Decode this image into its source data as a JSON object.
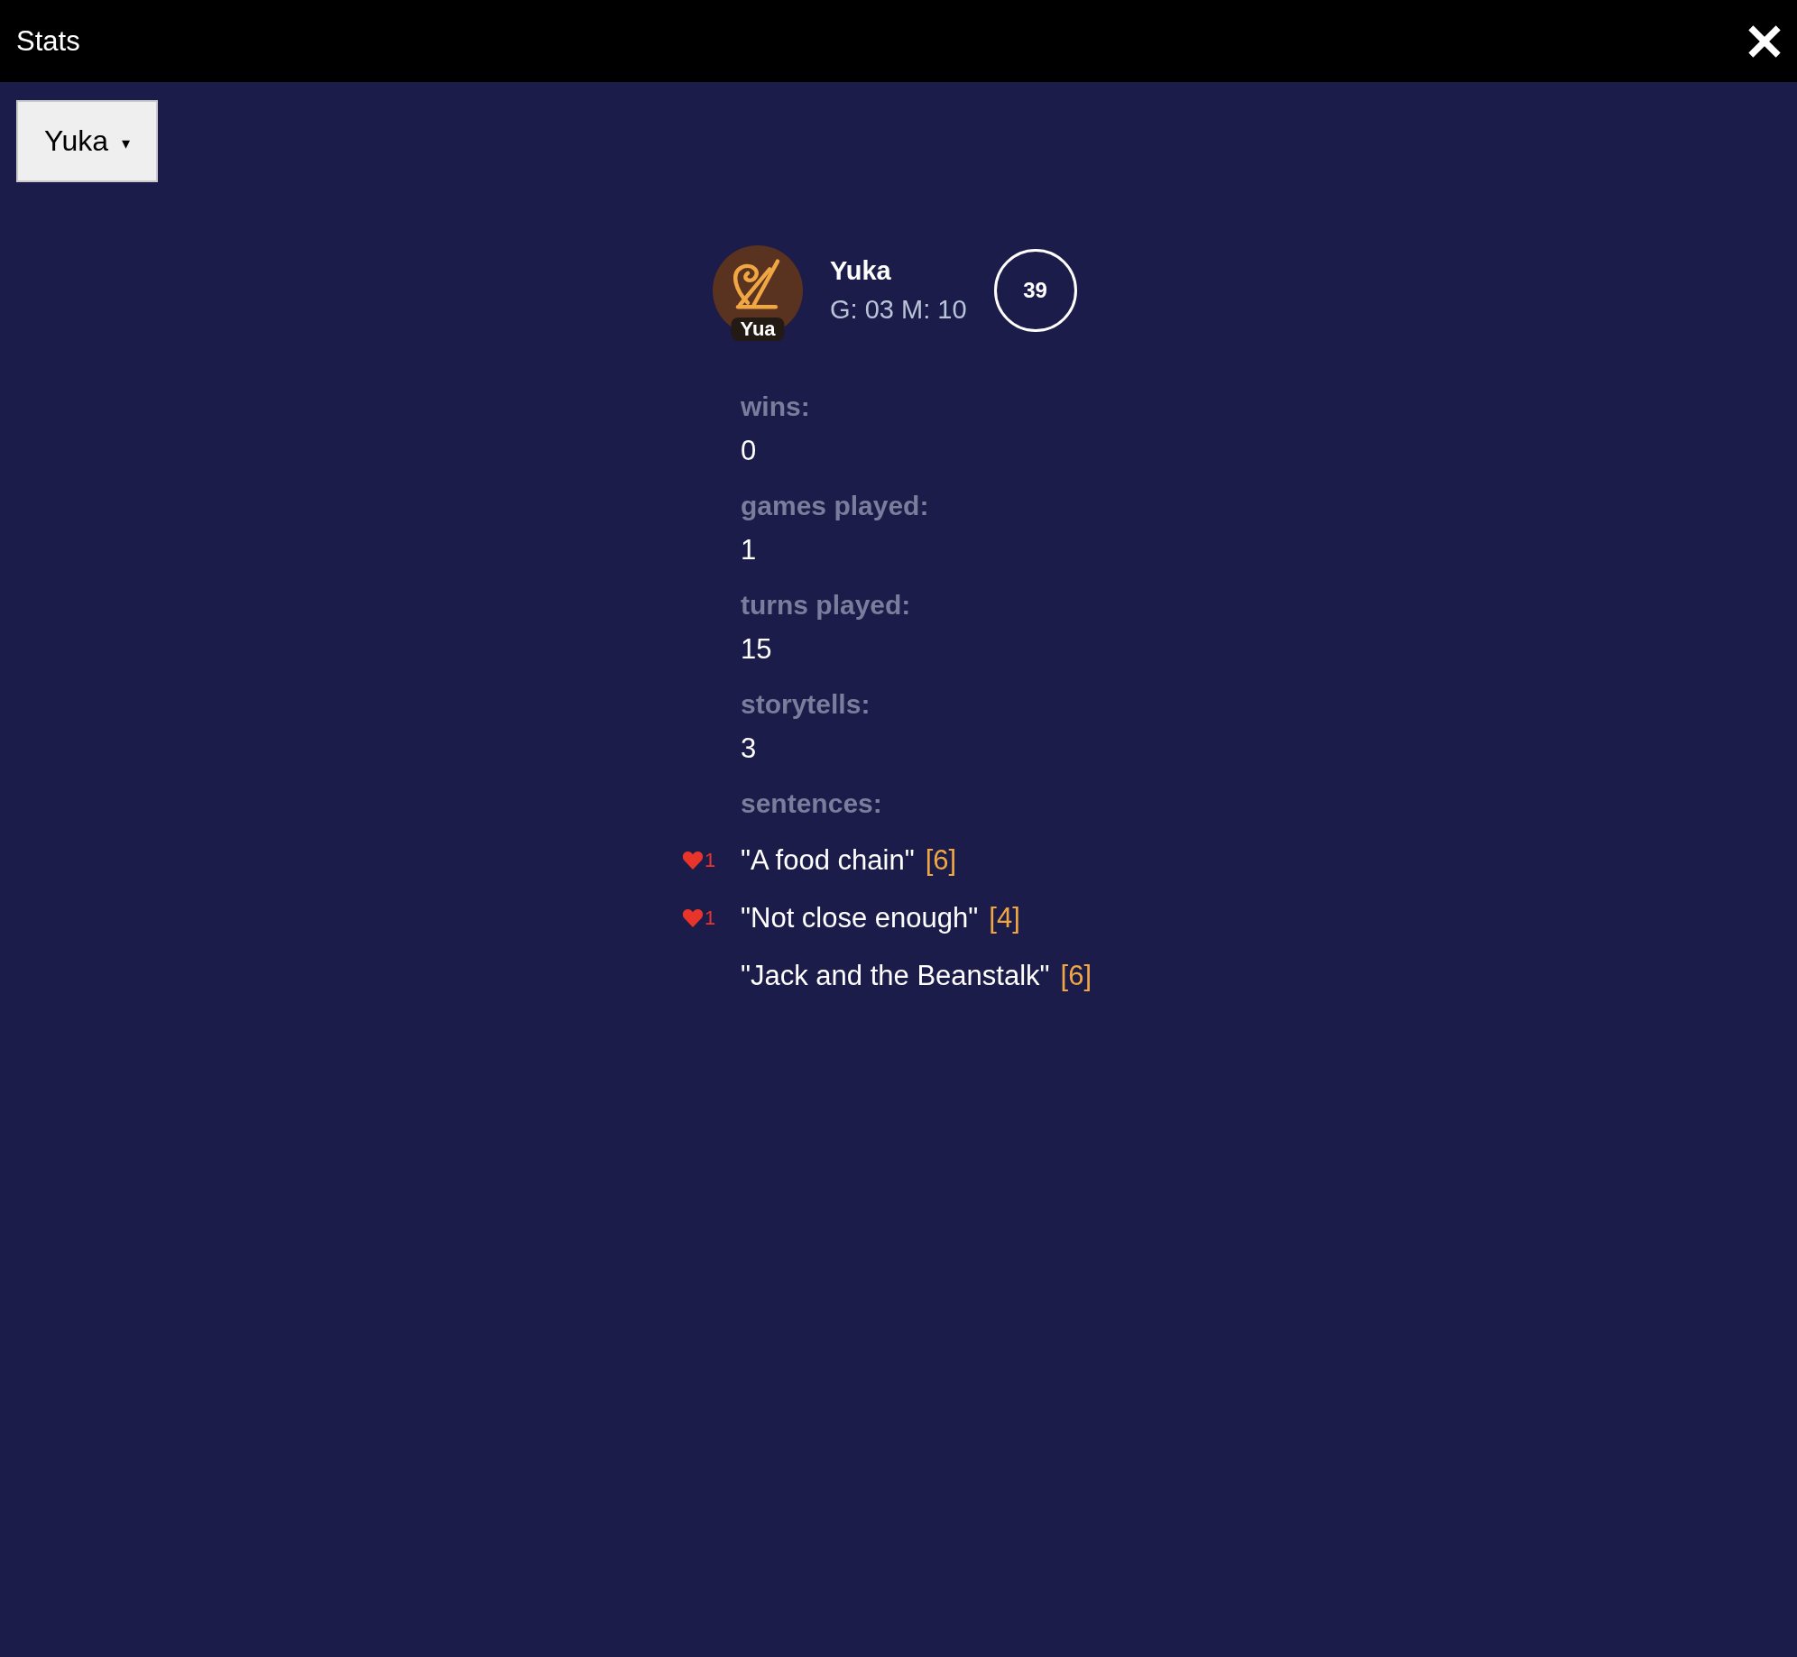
{
  "header": {
    "title": "Stats"
  },
  "player_select": {
    "value": "Yuka",
    "caret": "▾"
  },
  "profile": {
    "avatar_label": "Yua",
    "name": "Yuka",
    "detail": "G: 03 M: 10",
    "score": "39"
  },
  "stats": [
    {
      "label": "wins:",
      "value": "0"
    },
    {
      "label": "games played:",
      "value": "1"
    },
    {
      "label": "turns played:",
      "value": "15"
    },
    {
      "label": "storytells:",
      "value": "3"
    }
  ],
  "sentences": {
    "label": "sentences:",
    "items": [
      {
        "likes": "1",
        "text": "\"A food chain\"",
        "count": "[6]"
      },
      {
        "likes": "1",
        "text": "\"Not close enough\"",
        "count": "[4]"
      },
      {
        "text": "\"Jack and the Beanstalk\"",
        "count": "[6]"
      }
    ]
  }
}
